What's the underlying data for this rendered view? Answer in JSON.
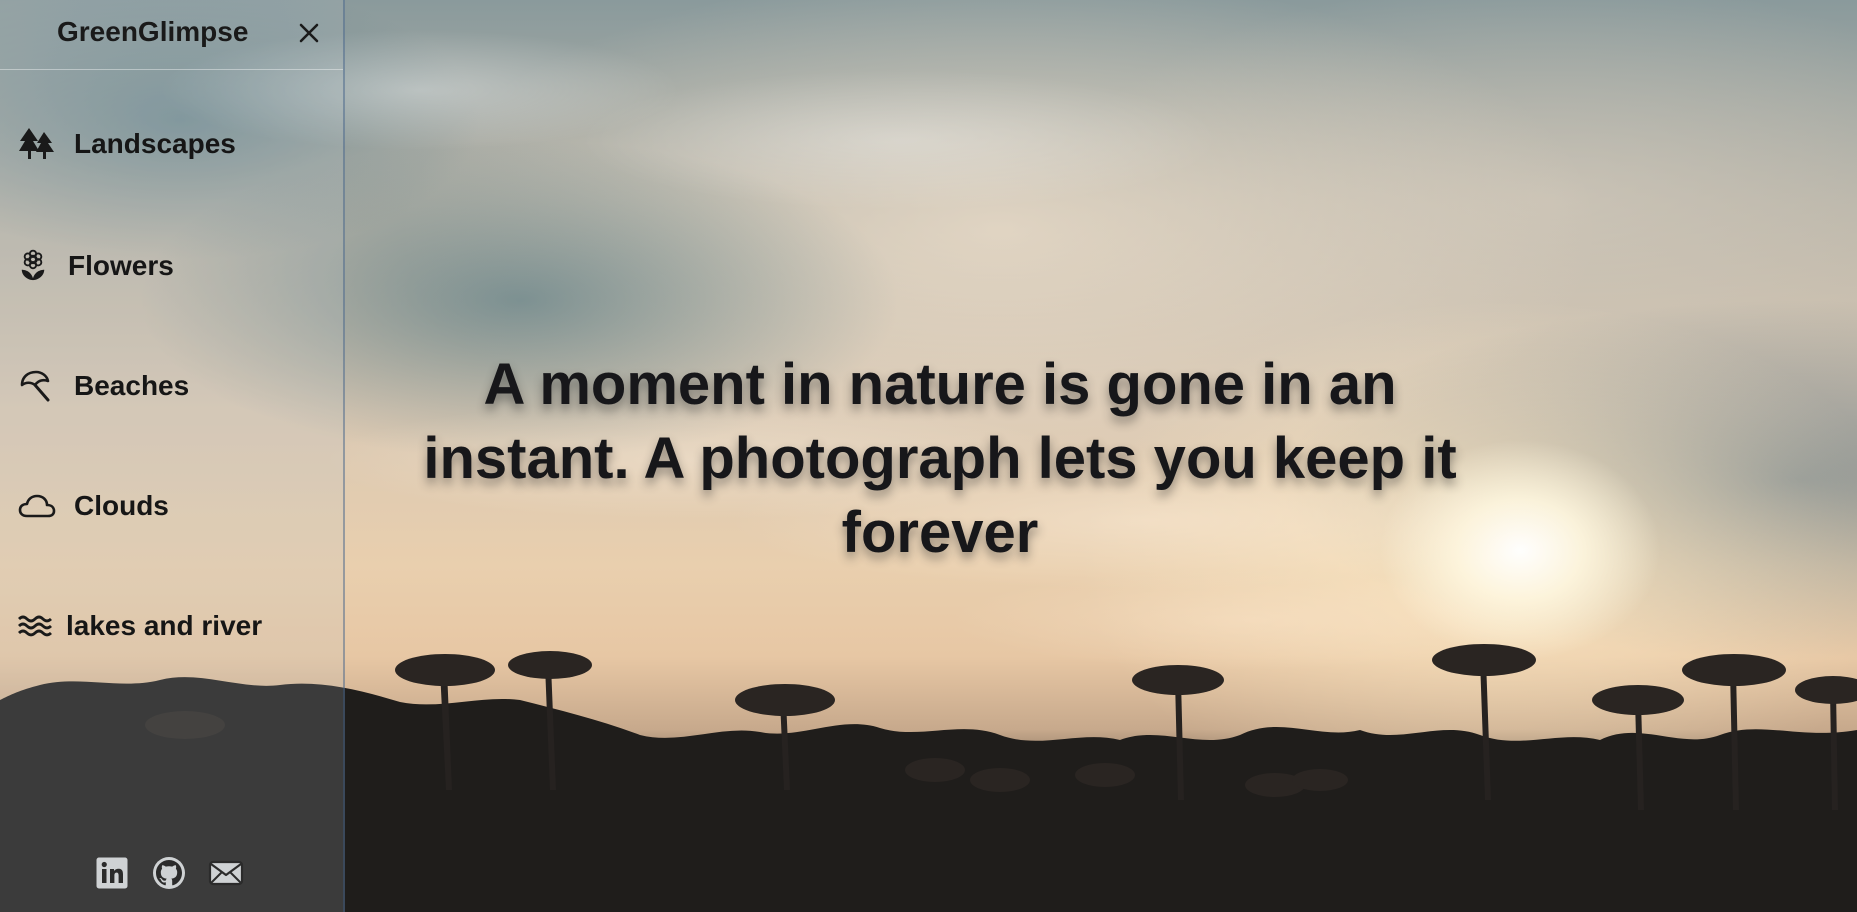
{
  "app": {
    "brand": "GreenGlimpse",
    "close_symbol": "✕"
  },
  "sidebar": {
    "items": [
      {
        "label": "Landscapes",
        "icon": "trees-icon"
      },
      {
        "label": "Flowers",
        "icon": "flower-icon"
      },
      {
        "label": "Beaches",
        "icon": "umbrella-icon"
      },
      {
        "label": "Clouds",
        "icon": "cloud-icon"
      },
      {
        "label": "lakes and river",
        "icon": "water-icon"
      }
    ],
    "social": [
      {
        "icon": "linkedin-icon"
      },
      {
        "icon": "github-icon"
      },
      {
        "icon": "mail-icon"
      }
    ]
  },
  "hero": {
    "quote": "A moment in nature is gone in an instant. A photograph lets you keep it forever"
  },
  "colors": {
    "text": "#17171a",
    "sidebar_border": "#3c5a82"
  }
}
